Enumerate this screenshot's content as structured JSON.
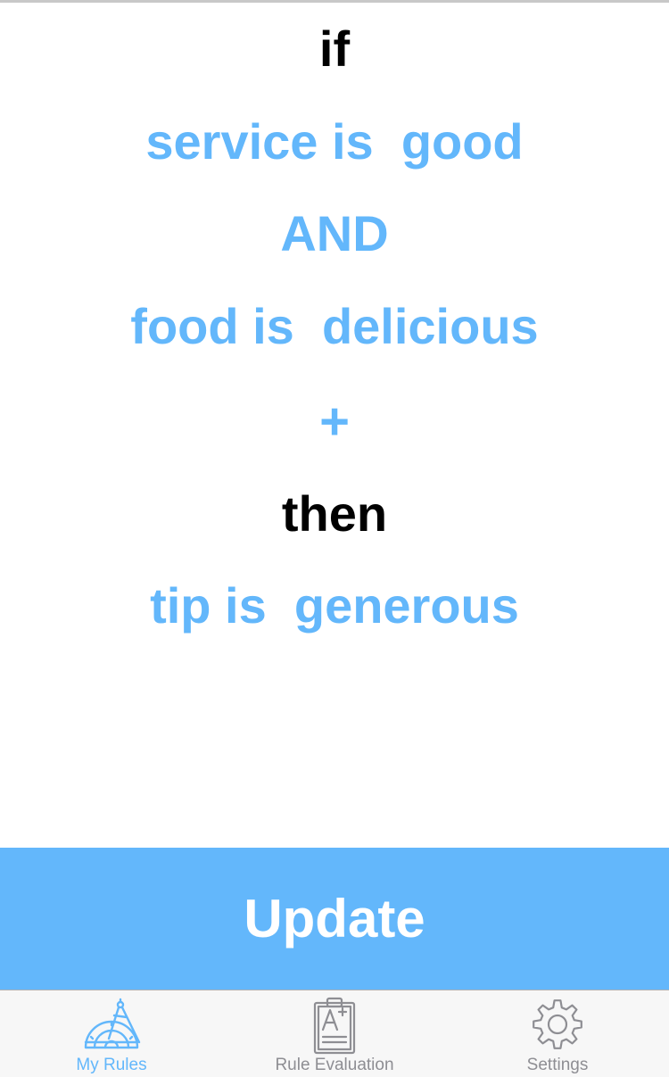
{
  "rule": {
    "if_keyword": "if",
    "condition_1": "service is  good",
    "operator": "AND",
    "condition_2": "food is  delicious",
    "add_symbol": "+",
    "then_keyword": "then",
    "consequence": "tip is  generous"
  },
  "actions": {
    "update_label": "Update"
  },
  "tab_bar": {
    "tabs": [
      {
        "label": "My Rules",
        "icon": "compass-ruler-icon",
        "active": true
      },
      {
        "label": "Rule Evaluation",
        "icon": "clipboard-grade-icon",
        "active": false
      },
      {
        "label": "Settings",
        "icon": "gear-icon",
        "active": false
      }
    ]
  },
  "colors": {
    "accent": "#63b7fb",
    "keyword": "#000000",
    "inactive_tab": "#8e8e93",
    "tab_bar_background": "#f7f7f7"
  }
}
